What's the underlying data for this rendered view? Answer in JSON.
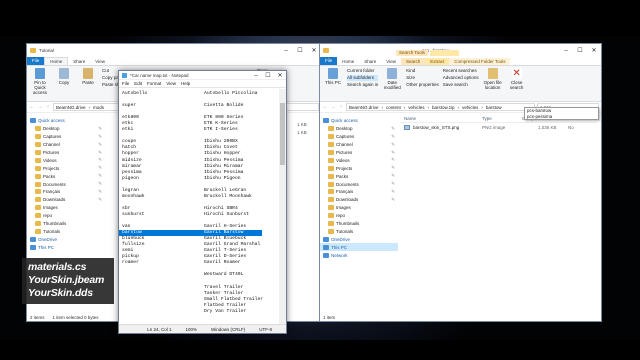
{
  "left": {
    "title": "Tutorial",
    "tabs": [
      "File",
      "Home",
      "Share",
      "View"
    ],
    "ribbon": {
      "pin": "Pin to Quick access",
      "copy": "Copy",
      "paste": "Paste",
      "cut": "Cut",
      "copy_path": "Copy path",
      "paste_shortcut": "Paste shortcut",
      "group": "Clipboard",
      "open": "Open",
      "select_all": "Select all"
    },
    "address": [
      "BeamNG.drive",
      "mods"
    ],
    "sidebar": [
      {
        "label": "Quick access",
        "top": true
      },
      {
        "label": "Desktop"
      },
      {
        "label": "Captures"
      },
      {
        "label": "Channel"
      },
      {
        "label": "Pictures"
      },
      {
        "label": "Videos"
      },
      {
        "label": "Projects"
      },
      {
        "label": "Packs"
      },
      {
        "label": "Documents"
      },
      {
        "label": "Français"
      },
      {
        "label": "Downloads"
      },
      {
        "label": "Images"
      },
      {
        "label": "repo"
      },
      {
        "label": "Thumbnails"
      },
      {
        "label": "Tutorials"
      },
      {
        "label": "OneDrive",
        "top": true
      },
      {
        "label": "This PC",
        "top": true
      }
    ],
    "status": [
      "2 items",
      "1 item selected 0 bytes"
    ],
    "sizes": [
      "1 KB",
      "1 KB"
    ]
  },
  "notepad": {
    "title": "*Car name map.txt - Notepad",
    "menu": [
      "File",
      "Edit",
      "Format",
      "View",
      "Help"
    ],
    "lines": [
      [
        "Autobello",
        "Autobello Piccolina"
      ],
      [
        "",
        ""
      ],
      [
        "super",
        "Civetta Bolide"
      ],
      [
        "",
        ""
      ],
      [
        "etk800",
        "ETK 800 Series"
      ],
      [
        "etkc",
        "ETK K-Series"
      ],
      [
        "etki",
        "ETK I-Series"
      ],
      [
        "",
        ""
      ],
      [
        "coupe",
        "Ibishu 200BX"
      ],
      [
        "hatch",
        "Ibishu Covet"
      ],
      [
        "hopper",
        "Ibishu Hopper"
      ],
      [
        "midsize",
        "Ibishu Pessima"
      ],
      [
        "miramar",
        "Ibishu Miramar"
      ],
      [
        "pessima",
        "Ibishu Pessima"
      ],
      [
        "pigeon",
        "Ibishu Pigeon"
      ],
      [
        "",
        ""
      ],
      [
        "legran",
        "Bruckell LeGran"
      ],
      [
        "moonhawk",
        "Bruckell Moonhawk"
      ],
      [
        "",
        ""
      ],
      [
        "sbr",
        "Hirochi SBR4"
      ],
      [
        "sunburst",
        "Hirochi Sunburst"
      ],
      [
        "",
        ""
      ],
      [
        "van",
        "Gavril H-Series"
      ],
      [
        "barstow",
        "Gavril Barstow"
      ],
      [
        "bluebuck",
        "Gavril Bluebuck"
      ],
      [
        "fullsize",
        "Gavril Grand Marshal"
      ],
      [
        "semi",
        "Gavril T-Series"
      ],
      [
        "pickup",
        "Gavril D-Series"
      ],
      [
        "roamer",
        "Gavril Roamer"
      ],
      [
        "",
        ""
      ],
      [
        "",
        "Wentward DT40L"
      ],
      [
        "",
        ""
      ],
      [
        "",
        "Travel Trailer"
      ],
      [
        "",
        "Tanker Trailer"
      ],
      [
        "",
        "Small Flatbed Trailer"
      ],
      [
        "",
        "Flatbed Trailer"
      ],
      [
        "",
        "Dry Van Trailer"
      ]
    ],
    "highlight_index": 23,
    "status": {
      "pos": "Ln 24, Col 1",
      "zoom": "100%",
      "eol": "Windows (CRLF)",
      "enc": "UTF-8"
    }
  },
  "right": {
    "title": "pcs - barstow",
    "tabs": [
      "File",
      "Home",
      "Share",
      "View",
      "Search",
      "Extract"
    ],
    "context_tabs": {
      "search_tools": "Search Tools",
      "compressed": "Compressed Folder Tools"
    },
    "ribbon": {
      "this_pc": "This PC",
      "current_folder": "Current folder",
      "all_subfolders": "All subfolders",
      "search_again": "Search again in",
      "date_modified": "Date modified",
      "kind": "Kind",
      "size": "Size",
      "other_props": "Other properties",
      "recent": "Recent searches",
      "advanced": "Advanced options",
      "open_loc": "Open file location",
      "save": "Save search",
      "close": "Close search",
      "g_location": "Location",
      "g_refine": "Refine",
      "g_options": "Options"
    },
    "address": [
      "BeamNG.drive",
      "content",
      "vehicles",
      "barstow.zip",
      "vehicles",
      "barstow"
    ],
    "search_value": "pcs",
    "dropdown": [
      "pcs-barstow",
      "pcs-pessima"
    ],
    "sidebar": [
      {
        "label": "Quick access",
        "top": true
      },
      {
        "label": "Desktop"
      },
      {
        "label": "Captures"
      },
      {
        "label": "Channel"
      },
      {
        "label": "Pictures"
      },
      {
        "label": "Videos"
      },
      {
        "label": "Projects"
      },
      {
        "label": "Packs"
      },
      {
        "label": "Documents"
      },
      {
        "label": "Français"
      },
      {
        "label": "Downloads"
      },
      {
        "label": "Images"
      },
      {
        "label": "repo"
      },
      {
        "label": "Thumbnails"
      },
      {
        "label": "Tutorials"
      },
      {
        "label": "OneDrive",
        "top": true
      },
      {
        "label": "This PC",
        "top": true,
        "sel": true
      },
      {
        "label": "Network",
        "top": true
      }
    ],
    "columns": [
      "Name",
      "Type",
      "Compressed size"
    ],
    "files": [
      {
        "name": "barstow_skin_STS.png",
        "type": "PNG image",
        "size": "1,036 KB",
        "extra": "No"
      }
    ],
    "status": [
      "1 item"
    ]
  },
  "overlay": [
    "materials.cs",
    "YourSkin.jbeam",
    "YourSkin.dds"
  ],
  "colors": {
    "accent": "#1979ca",
    "selection": "#0078d7",
    "folder": "#e8b84a"
  }
}
